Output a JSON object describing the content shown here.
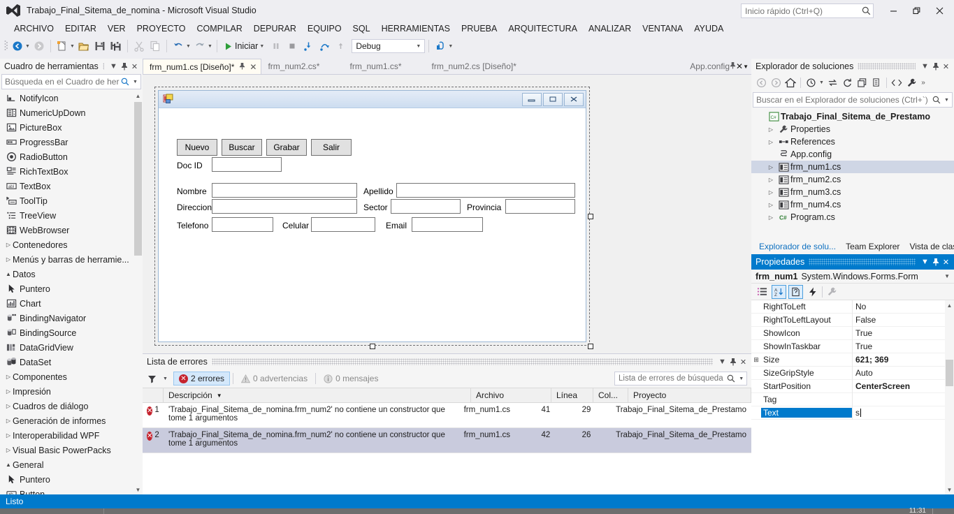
{
  "window": {
    "title": "Trabajo_Final_Sitema_de_nomina - Microsoft Visual Studio",
    "quick_launch_placeholder": "Inicio rápido (Ctrl+Q)",
    "minimize": "—",
    "restore": "❐",
    "close": "✕"
  },
  "menu": [
    {
      "label": "ARCHIVO"
    },
    {
      "label": "EDITAR"
    },
    {
      "label": "VER"
    },
    {
      "label": "PROYECTO"
    },
    {
      "label": "COMPILAR"
    },
    {
      "label": "DEPURAR"
    },
    {
      "label": "EQUIPO"
    },
    {
      "label": "SQL"
    },
    {
      "label": "HERRAMIENTAS"
    },
    {
      "label": "PRUEBA"
    },
    {
      "label": "ARQUITECTURA"
    },
    {
      "label": "ANALIZAR"
    },
    {
      "label": "VENTANA"
    },
    {
      "label": "AYUDA"
    }
  ],
  "toolbar": {
    "start_label": "Iniciar",
    "config": "Debug"
  },
  "toolbox": {
    "title": "Cuadro de herramientas",
    "search_placeholder": "Búsqueda en el Cuadro de her",
    "items": [
      {
        "label": "NotifyIcon",
        "icon": "notifyicon-icon",
        "type": "item"
      },
      {
        "label": "NumericUpDown",
        "icon": "numericupdown-icon",
        "type": "item"
      },
      {
        "label": "PictureBox",
        "icon": "picturebox-icon",
        "type": "item"
      },
      {
        "label": "ProgressBar",
        "icon": "progressbar-icon",
        "type": "item"
      },
      {
        "label": "RadioButton",
        "icon": "radiobutton-icon",
        "type": "item"
      },
      {
        "label": "RichTextBox",
        "icon": "richtextbox-icon",
        "type": "item"
      },
      {
        "label": "TextBox",
        "icon": "textbox-icon",
        "type": "item"
      },
      {
        "label": "ToolTip",
        "icon": "tooltip-icon",
        "type": "item"
      },
      {
        "label": "TreeView",
        "icon": "treeview-icon",
        "type": "item"
      },
      {
        "label": "WebBrowser",
        "icon": "webbrowser-icon",
        "type": "item"
      },
      {
        "label": "Contenedores",
        "type": "category",
        "expanded": false
      },
      {
        "label": "Menús y barras de herramie...",
        "type": "category",
        "expanded": false
      },
      {
        "label": "Datos",
        "type": "category",
        "expanded": true
      },
      {
        "label": "Puntero",
        "icon": "pointer-icon",
        "type": "item"
      },
      {
        "label": "Chart",
        "icon": "chart-icon",
        "type": "item"
      },
      {
        "label": "BindingNavigator",
        "icon": "bindingnavigator-icon",
        "type": "item"
      },
      {
        "label": "BindingSource",
        "icon": "bindingsource-icon",
        "type": "item"
      },
      {
        "label": "DataGridView",
        "icon": "datagridview-icon",
        "type": "item"
      },
      {
        "label": "DataSet",
        "icon": "dataset-icon",
        "type": "item"
      },
      {
        "label": "Componentes",
        "type": "category",
        "expanded": false
      },
      {
        "label": "Impresión",
        "type": "category",
        "expanded": false
      },
      {
        "label": "Cuadros de diálogo",
        "type": "category",
        "expanded": false
      },
      {
        "label": "Generación de informes",
        "type": "category",
        "expanded": false
      },
      {
        "label": "Interoperabilidad WPF",
        "type": "category",
        "expanded": false
      },
      {
        "label": "Visual Basic PowerPacks",
        "type": "category",
        "expanded": false
      },
      {
        "label": "General",
        "type": "category",
        "expanded": true
      },
      {
        "label": "Puntero",
        "icon": "pointer-icon",
        "type": "item"
      },
      {
        "label": "Button",
        "icon": "button-icon",
        "type": "item"
      }
    ]
  },
  "tabs": [
    {
      "label": "frm_num1.cs [Diseño]*",
      "active": true
    },
    {
      "label": "frm_num2.cs*",
      "active": false
    },
    {
      "label": "frm_num1.cs*",
      "active": false
    },
    {
      "label": "frm_num2.cs [Diseño]*",
      "active": false
    }
  ],
  "tab_right": {
    "label": "App.config"
  },
  "designer": {
    "form_buttons": [
      {
        "label": "Nuevo"
      },
      {
        "label": "Buscar"
      },
      {
        "label": "Grabar"
      },
      {
        "label": "Salir"
      }
    ],
    "fields": [
      {
        "label": "Doc ID",
        "value": ""
      },
      {
        "label": "Nombre",
        "value": ""
      },
      {
        "label": "Apellido",
        "value": ""
      },
      {
        "label": "Direccion",
        "value": ""
      },
      {
        "label": "Sector",
        "value": ""
      },
      {
        "label": "Provincia",
        "value": ""
      },
      {
        "label": "Telefono",
        "value": ""
      },
      {
        "label": "Celular",
        "value": ""
      },
      {
        "label": "Email",
        "value": ""
      }
    ],
    "form_title": ""
  },
  "errorlist": {
    "title": "Lista de errores",
    "errors_label": "2 errores",
    "warnings_label": "0 advertencias",
    "messages_label": "0 mensajes",
    "search_placeholder": "Lista de errores de búsqueda",
    "columns": [
      "",
      "Descripción",
      "Archivo",
      "Línea",
      "Col...",
      "Proyecto"
    ],
    "rows": [
      {
        "num": "1",
        "desc": "'Trabajo_Final_Sitema_de_nomina.frm_num2' no contiene un constructor que tome 1 argumentos",
        "file": "frm_num1.cs",
        "line": "41",
        "col": "29",
        "project": "Trabajo_Final_Sitema_de_Prestamo"
      },
      {
        "num": "2",
        "desc": "'Trabajo_Final_Sitema_de_nomina.frm_num2' no contiene un constructor que tome 1 argumentos",
        "file": "frm_num1.cs",
        "line": "42",
        "col": "26",
        "project": "Trabajo_Final_Sitema_de_Prestamo"
      }
    ]
  },
  "solution_explorer": {
    "title": "Explorador de soluciones",
    "search_placeholder": "Buscar en el Explorador de soluciones (Ctrl+`)",
    "tree": [
      {
        "label": "Trabajo_Final_Sitema_de_Prestamo",
        "icon": "csharp-project-icon",
        "indent": 0,
        "expander": false,
        "bold": true,
        "selected": false
      },
      {
        "label": "Properties",
        "icon": "wrench-icon",
        "indent": 1,
        "expander": true,
        "bold": false,
        "selected": false
      },
      {
        "label": "References",
        "icon": "references-icon",
        "indent": 1,
        "expander": true,
        "bold": false,
        "selected": false
      },
      {
        "label": "App.config",
        "icon": "config-icon",
        "indent": 1,
        "expander": false,
        "bold": false,
        "selected": false
      },
      {
        "label": "frm_num1.cs",
        "icon": "form-icon",
        "indent": 1,
        "expander": true,
        "bold": false,
        "selected": true
      },
      {
        "label": "frm_num2.cs",
        "icon": "form-icon",
        "indent": 1,
        "expander": true,
        "bold": false,
        "selected": false
      },
      {
        "label": "frm_num3.cs",
        "icon": "form-icon",
        "indent": 1,
        "expander": true,
        "bold": false,
        "selected": false
      },
      {
        "label": "frm_num4.cs",
        "icon": "form-icon",
        "indent": 1,
        "expander": true,
        "bold": false,
        "selected": false
      },
      {
        "label": "Program.cs",
        "icon": "csharp-file-icon",
        "indent": 1,
        "expander": true,
        "bold": false,
        "selected": false
      }
    ],
    "bottom_tabs": [
      {
        "label": "Explorador de solu...",
        "active": true
      },
      {
        "label": "Team Explorer",
        "active": false
      },
      {
        "label": "Vista de clases",
        "active": false
      }
    ]
  },
  "properties": {
    "title": "Propiedades",
    "object_name": "frm_num1",
    "object_type": "System.Windows.Forms.Form",
    "rows": [
      {
        "name": "RightToLeft",
        "value": "No",
        "bold": false,
        "expandable": false,
        "selected": false
      },
      {
        "name": "RightToLeftLayout",
        "value": "False",
        "bold": false,
        "expandable": false,
        "selected": false
      },
      {
        "name": "ShowIcon",
        "value": "True",
        "bold": false,
        "expandable": false,
        "selected": false
      },
      {
        "name": "ShowInTaskbar",
        "value": "True",
        "bold": false,
        "expandable": false,
        "selected": false
      },
      {
        "name": "Size",
        "value": "621; 369",
        "bold": true,
        "expandable": true,
        "selected": false
      },
      {
        "name": "SizeGripStyle",
        "value": "Auto",
        "bold": false,
        "expandable": false,
        "selected": false
      },
      {
        "name": "StartPosition",
        "value": "CenterScreen",
        "bold": true,
        "expandable": false,
        "selected": false
      },
      {
        "name": "Tag",
        "value": "",
        "bold": false,
        "expandable": false,
        "selected": false
      },
      {
        "name": "Text",
        "value": "s",
        "bold": false,
        "expandable": false,
        "selected": true
      }
    ]
  },
  "statusbar": {
    "text": "Listo"
  },
  "taskbar": {
    "clock": "11:31"
  },
  "colors": {
    "accent": "#007acc",
    "error": "#c5232e",
    "chrome": "#eeeef2",
    "pane": "#f5f5f5"
  }
}
